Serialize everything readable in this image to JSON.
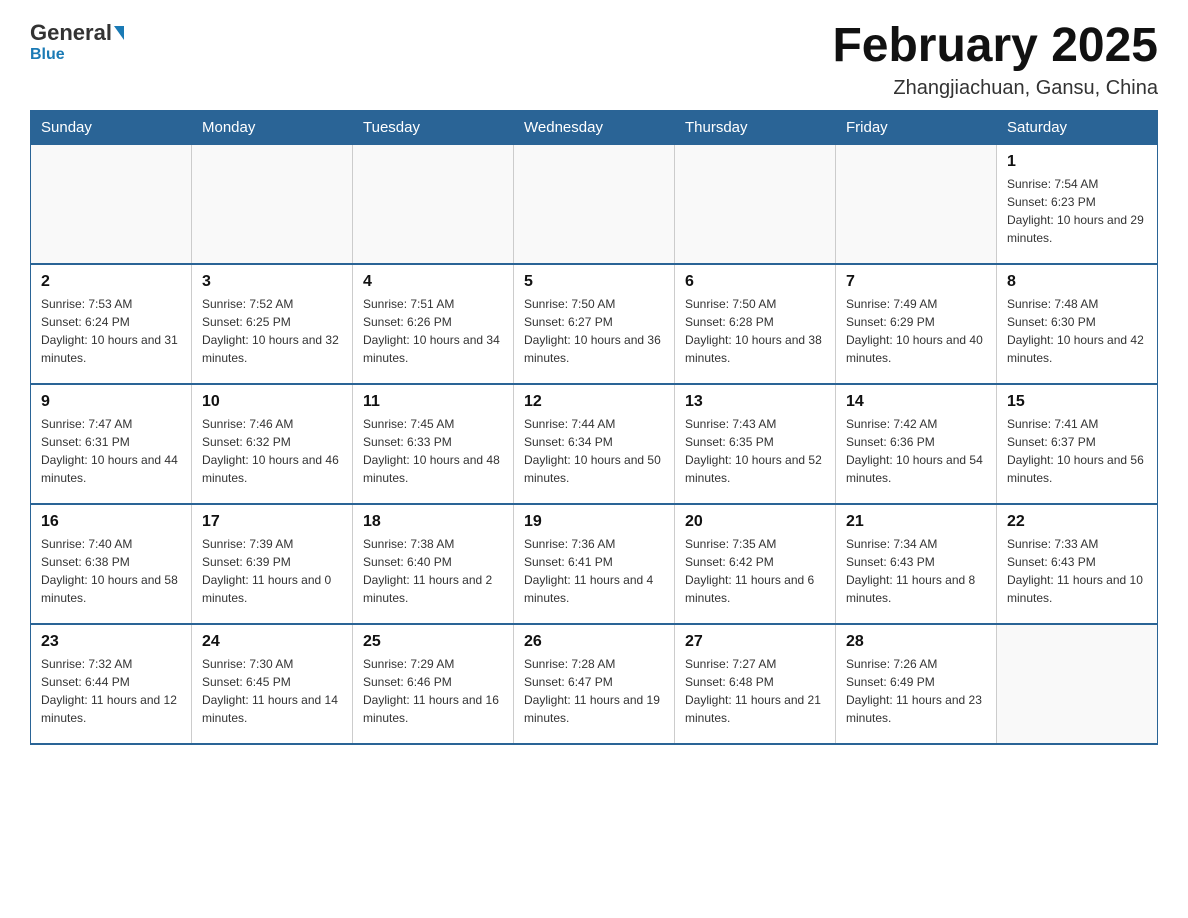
{
  "header": {
    "logo_general": "General",
    "logo_blue": "Blue",
    "month_title": "February 2025",
    "location": "Zhangjiachuan, Gansu, China"
  },
  "weekdays": [
    "Sunday",
    "Monday",
    "Tuesday",
    "Wednesday",
    "Thursday",
    "Friday",
    "Saturday"
  ],
  "weeks": [
    [
      {
        "day": "",
        "info": ""
      },
      {
        "day": "",
        "info": ""
      },
      {
        "day": "",
        "info": ""
      },
      {
        "day": "",
        "info": ""
      },
      {
        "day": "",
        "info": ""
      },
      {
        "day": "",
        "info": ""
      },
      {
        "day": "1",
        "info": "Sunrise: 7:54 AM\nSunset: 6:23 PM\nDaylight: 10 hours and 29 minutes."
      }
    ],
    [
      {
        "day": "2",
        "info": "Sunrise: 7:53 AM\nSunset: 6:24 PM\nDaylight: 10 hours and 31 minutes."
      },
      {
        "day": "3",
        "info": "Sunrise: 7:52 AM\nSunset: 6:25 PM\nDaylight: 10 hours and 32 minutes."
      },
      {
        "day": "4",
        "info": "Sunrise: 7:51 AM\nSunset: 6:26 PM\nDaylight: 10 hours and 34 minutes."
      },
      {
        "day": "5",
        "info": "Sunrise: 7:50 AM\nSunset: 6:27 PM\nDaylight: 10 hours and 36 minutes."
      },
      {
        "day": "6",
        "info": "Sunrise: 7:50 AM\nSunset: 6:28 PM\nDaylight: 10 hours and 38 minutes."
      },
      {
        "day": "7",
        "info": "Sunrise: 7:49 AM\nSunset: 6:29 PM\nDaylight: 10 hours and 40 minutes."
      },
      {
        "day": "8",
        "info": "Sunrise: 7:48 AM\nSunset: 6:30 PM\nDaylight: 10 hours and 42 minutes."
      }
    ],
    [
      {
        "day": "9",
        "info": "Sunrise: 7:47 AM\nSunset: 6:31 PM\nDaylight: 10 hours and 44 minutes."
      },
      {
        "day": "10",
        "info": "Sunrise: 7:46 AM\nSunset: 6:32 PM\nDaylight: 10 hours and 46 minutes."
      },
      {
        "day": "11",
        "info": "Sunrise: 7:45 AM\nSunset: 6:33 PM\nDaylight: 10 hours and 48 minutes."
      },
      {
        "day": "12",
        "info": "Sunrise: 7:44 AM\nSunset: 6:34 PM\nDaylight: 10 hours and 50 minutes."
      },
      {
        "day": "13",
        "info": "Sunrise: 7:43 AM\nSunset: 6:35 PM\nDaylight: 10 hours and 52 minutes."
      },
      {
        "day": "14",
        "info": "Sunrise: 7:42 AM\nSunset: 6:36 PM\nDaylight: 10 hours and 54 minutes."
      },
      {
        "day": "15",
        "info": "Sunrise: 7:41 AM\nSunset: 6:37 PM\nDaylight: 10 hours and 56 minutes."
      }
    ],
    [
      {
        "day": "16",
        "info": "Sunrise: 7:40 AM\nSunset: 6:38 PM\nDaylight: 10 hours and 58 minutes."
      },
      {
        "day": "17",
        "info": "Sunrise: 7:39 AM\nSunset: 6:39 PM\nDaylight: 11 hours and 0 minutes."
      },
      {
        "day": "18",
        "info": "Sunrise: 7:38 AM\nSunset: 6:40 PM\nDaylight: 11 hours and 2 minutes."
      },
      {
        "day": "19",
        "info": "Sunrise: 7:36 AM\nSunset: 6:41 PM\nDaylight: 11 hours and 4 minutes."
      },
      {
        "day": "20",
        "info": "Sunrise: 7:35 AM\nSunset: 6:42 PM\nDaylight: 11 hours and 6 minutes."
      },
      {
        "day": "21",
        "info": "Sunrise: 7:34 AM\nSunset: 6:43 PM\nDaylight: 11 hours and 8 minutes."
      },
      {
        "day": "22",
        "info": "Sunrise: 7:33 AM\nSunset: 6:43 PM\nDaylight: 11 hours and 10 minutes."
      }
    ],
    [
      {
        "day": "23",
        "info": "Sunrise: 7:32 AM\nSunset: 6:44 PM\nDaylight: 11 hours and 12 minutes."
      },
      {
        "day": "24",
        "info": "Sunrise: 7:30 AM\nSunset: 6:45 PM\nDaylight: 11 hours and 14 minutes."
      },
      {
        "day": "25",
        "info": "Sunrise: 7:29 AM\nSunset: 6:46 PM\nDaylight: 11 hours and 16 minutes."
      },
      {
        "day": "26",
        "info": "Sunrise: 7:28 AM\nSunset: 6:47 PM\nDaylight: 11 hours and 19 minutes."
      },
      {
        "day": "27",
        "info": "Sunrise: 7:27 AM\nSunset: 6:48 PM\nDaylight: 11 hours and 21 minutes."
      },
      {
        "day": "28",
        "info": "Sunrise: 7:26 AM\nSunset: 6:49 PM\nDaylight: 11 hours and 23 minutes."
      },
      {
        "day": "",
        "info": ""
      }
    ]
  ]
}
